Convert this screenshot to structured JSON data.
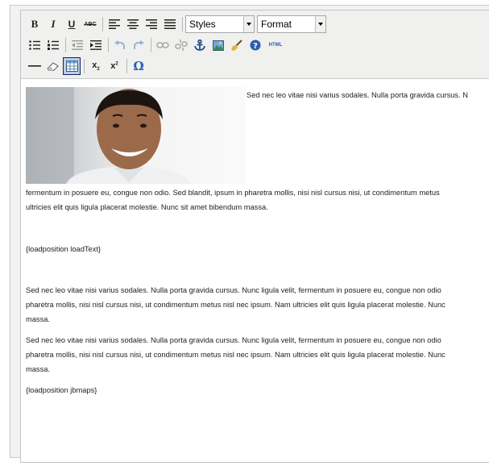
{
  "toolbar": {
    "styles_label": "Styles",
    "format_label": "Format",
    "html_label": "HTML",
    "bold_glyph": "B",
    "italic_glyph": "I",
    "underline_glyph": "U",
    "strike_glyph": "ABC",
    "omega_glyph": "Ω",
    "accent_color": "#2a5db0"
  },
  "content": {
    "line_beside_image": "Sed nec leo vitae nisi varius sodales. Nulla porta gravida cursus. N",
    "para1_l1": "fermentum in posuere eu, congue non odio. Sed blandit, ipsum in pharetra mollis, nisi nisl cursus nisi, ut condimentum metus",
    "para1_l2": "ultricies elit quis ligula placerat molestie. Nunc sit amet bibendum massa.",
    "load1": "{loadposition loadText}",
    "para2_l1": "Sed nec leo vitae nisi varius sodales. Nulla porta gravida cursus. Nunc ligula velit, fermentum in posuere eu, congue non odio",
    "para2_l2": "pharetra mollis, nisi nisl cursus nisi, ut condimentum metus nisl nec ipsum. Nam ultricies elit quis ligula placerat molestie. Nunc",
    "para2_l3": "massa.",
    "para3_l1": "Sed nec leo vitae nisi varius sodales. Nulla porta gravida cursus. Nunc ligula velit, fermentum in posuere eu, congue non odio",
    "para3_l2": "pharetra mollis, nisi nisl cursus nisi, ut condimentum metus nisl nec ipsum. Nam ultricies elit quis ligula placerat molestie. Nunc",
    "para3_l3": "massa.",
    "load2": "{loadposition jbmaps}"
  }
}
